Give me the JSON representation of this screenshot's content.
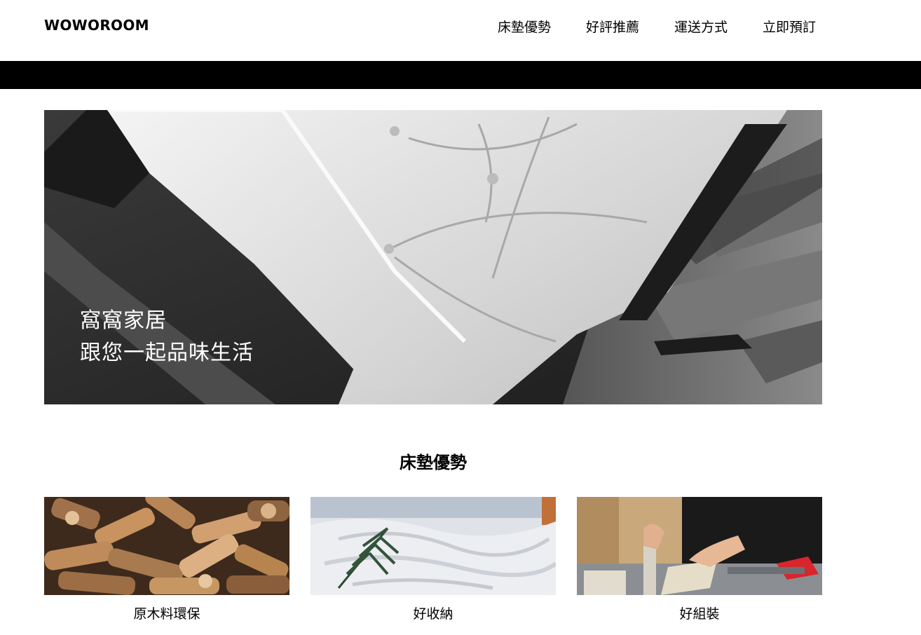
{
  "header": {
    "logo": "WOWOROOM",
    "nav": [
      "床墊優勢",
      "好評推薦",
      "運送方式",
      "立即預訂"
    ]
  },
  "hero": {
    "line1": "窩窩家居",
    "line2": "跟您一起品味生活"
  },
  "features": {
    "title": "床墊優勢",
    "items": [
      {
        "label": "原木料環保"
      },
      {
        "label": "好收納"
      },
      {
        "label": "好組裝"
      }
    ]
  },
  "colors": {
    "background": "#ffffff",
    "text": "#000000",
    "bar": "#000000",
    "hero_text": "#ffffff"
  }
}
